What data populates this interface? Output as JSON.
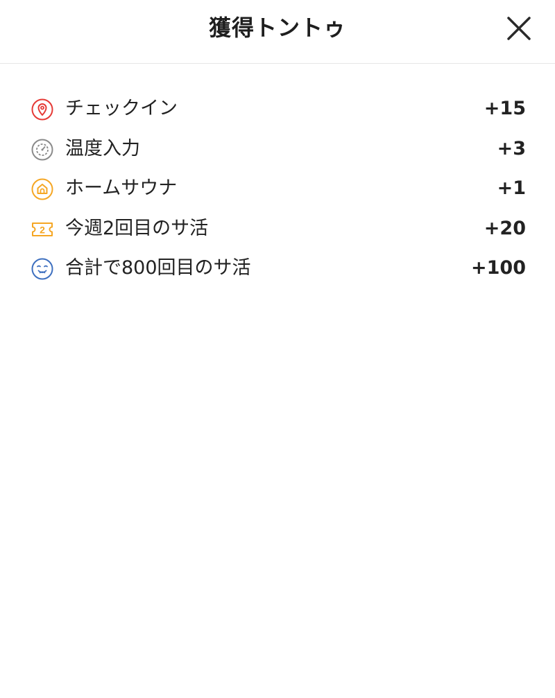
{
  "header": {
    "title": "獲得トントゥ",
    "close_icon": "close-icon"
  },
  "rows": [
    {
      "icon": "map-pin-icon",
      "color": "#e53935",
      "label": "チェックイン",
      "points": "+15"
    },
    {
      "icon": "thermometer-gauge-icon",
      "color": "#8a8a8a",
      "label": "温度入力",
      "points": "+3"
    },
    {
      "icon": "home-icon",
      "color": "#f5a623",
      "label": "ホームサウナ",
      "points": "+1"
    },
    {
      "icon": "ticket-2-icon",
      "color": "#f5a623",
      "label": "今週2回目のサ活",
      "points": "+20"
    },
    {
      "icon": "relaxed-face-icon",
      "color": "#3d6fbf",
      "label": "合計で800回目のサ活",
      "points": "+100"
    }
  ]
}
